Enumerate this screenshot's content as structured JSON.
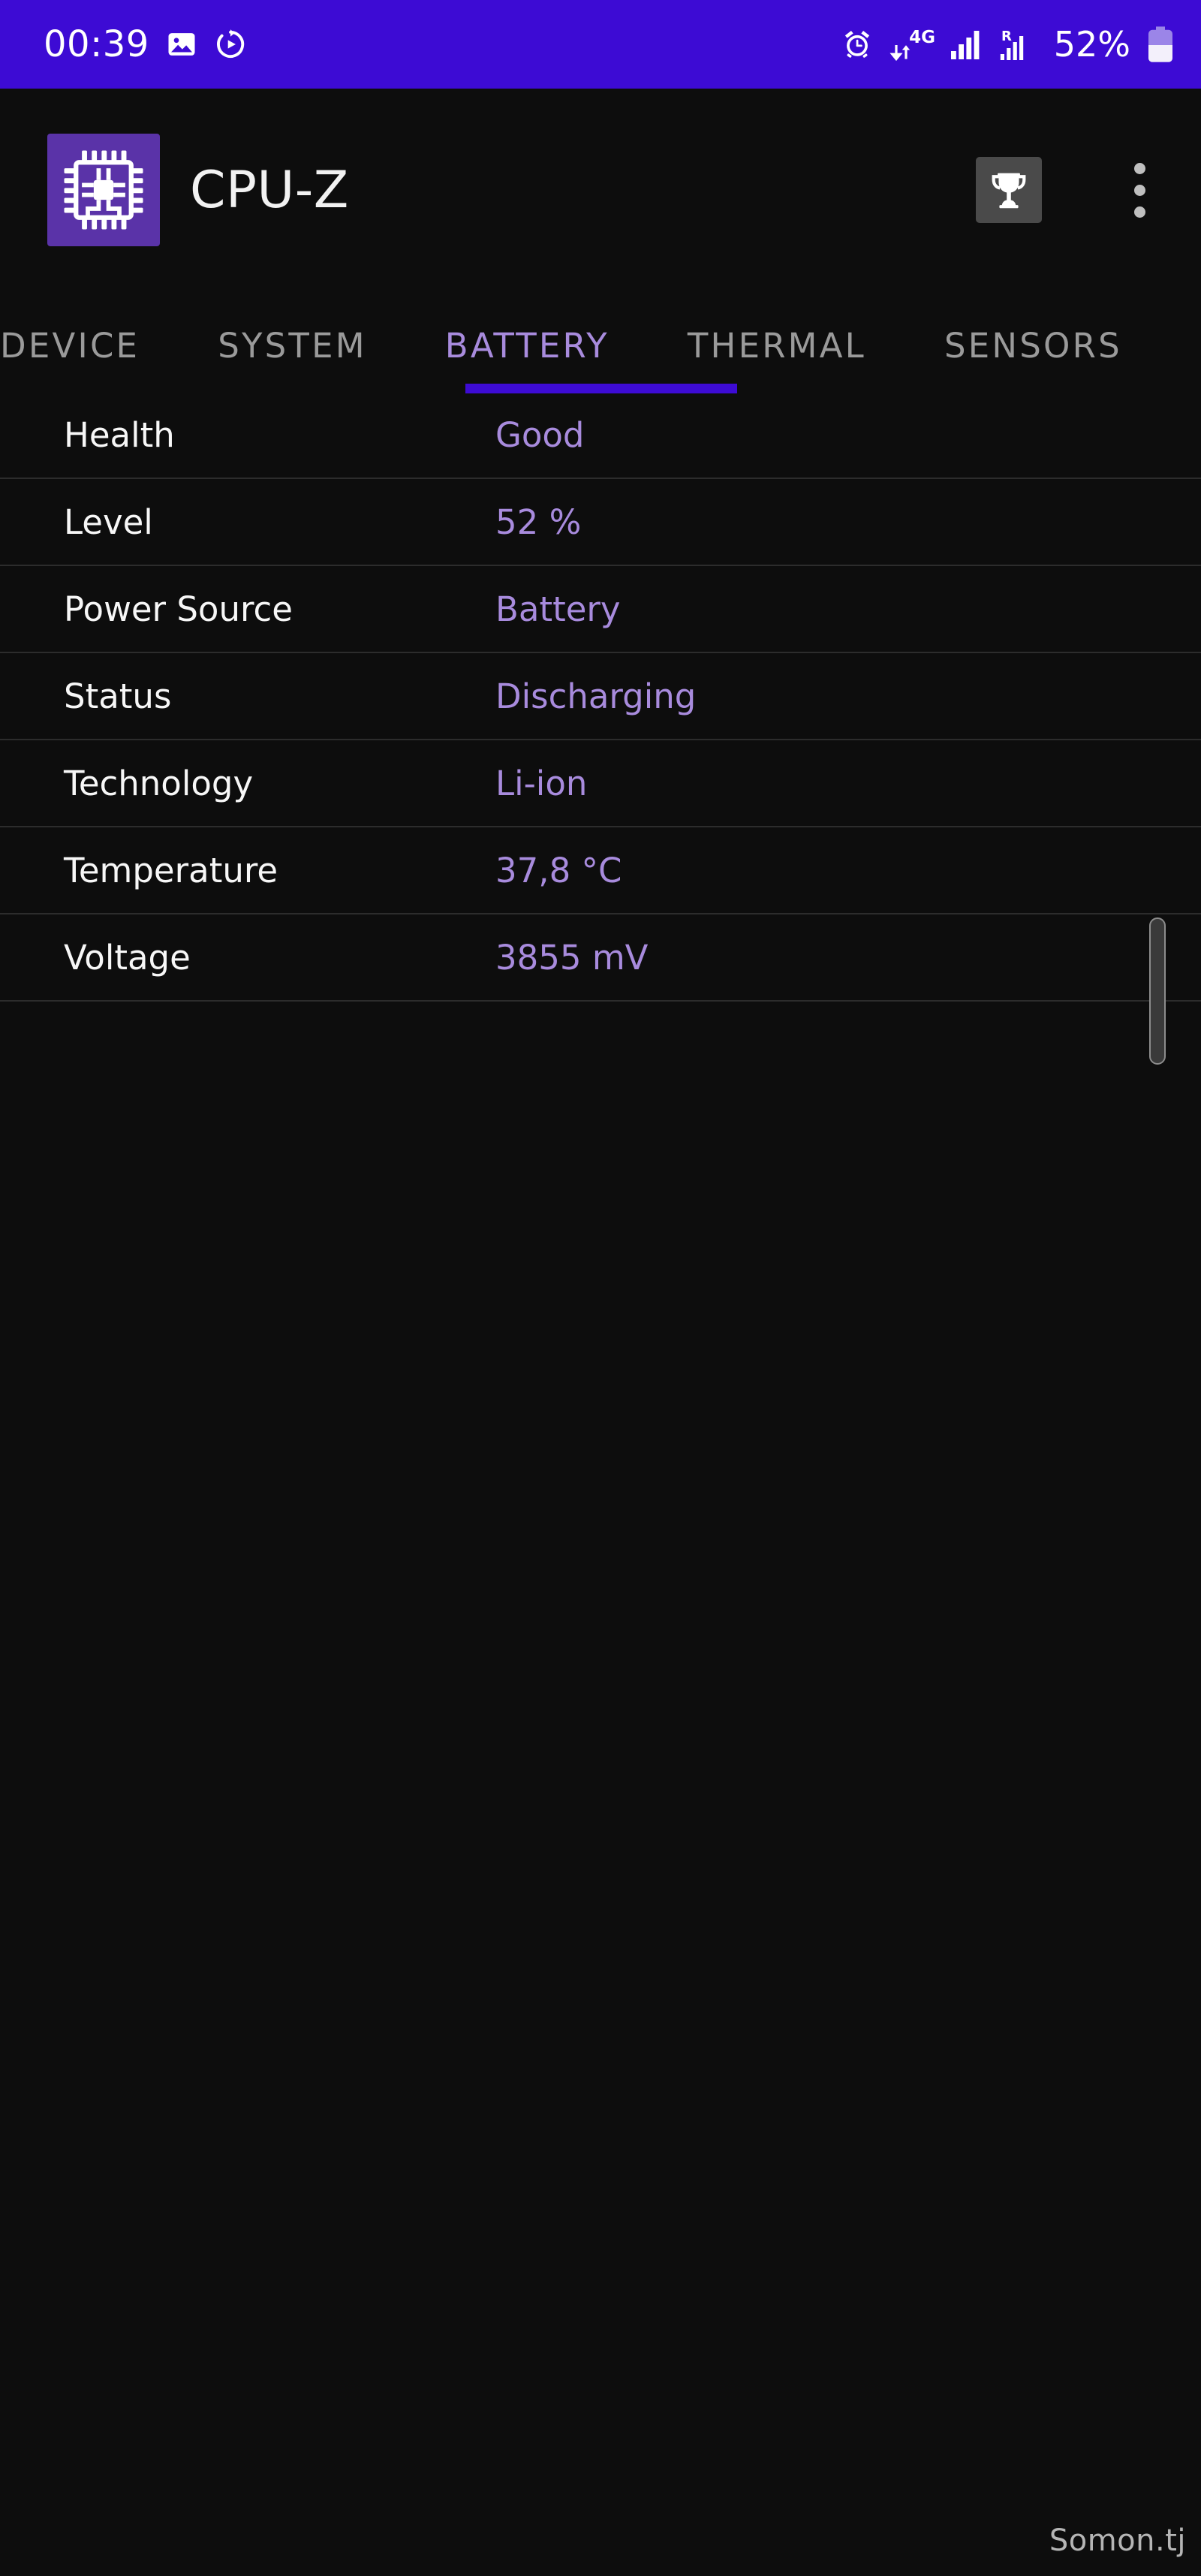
{
  "status_bar": {
    "time": "00:39",
    "battery_percent": "52%",
    "network_type": "4G",
    "icons": [
      "gallery-icon",
      "screen-record-icon",
      "alarm-clock-icon",
      "data-transfer-icon",
      "signal-bars-icon",
      "roaming-signal-icon",
      "battery-icon"
    ],
    "background_color": "#3d0bd4",
    "text_color": "#ffffff"
  },
  "app_bar": {
    "title": "CPU-Z",
    "logo_name": "cpu-chip-icon",
    "logo_color": "#5a33a8",
    "trophy_label": "benchmark-trophy",
    "overflow_label": "more-options"
  },
  "tabs": {
    "items": [
      {
        "label": "DEVICE",
        "active": false
      },
      {
        "label": "SYSTEM",
        "active": false
      },
      {
        "label": "BATTERY",
        "active": true
      },
      {
        "label": "THERMAL",
        "active": false
      },
      {
        "label": "SENSORS",
        "active": false
      }
    ],
    "active_index": 2,
    "active_color": "#a88bdd",
    "inactive_color": "#9a9a9a",
    "indicator_color": "#3d0bd4"
  },
  "battery": {
    "rows": [
      {
        "label": "Health",
        "value": "Good"
      },
      {
        "label": "Level",
        "value": "52 %"
      },
      {
        "label": "Power Source",
        "value": "Battery"
      },
      {
        "label": "Status",
        "value": "Discharging"
      },
      {
        "label": "Technology",
        "value": "Li-ion"
      },
      {
        "label": "Temperature",
        "value": "37,8 °C"
      },
      {
        "label": "Voltage",
        "value": "3855 mV"
      }
    ],
    "label_color": "#f7f7f7",
    "value_color": "#a88bdd"
  },
  "watermark": {
    "text": "Somon.tj"
  }
}
